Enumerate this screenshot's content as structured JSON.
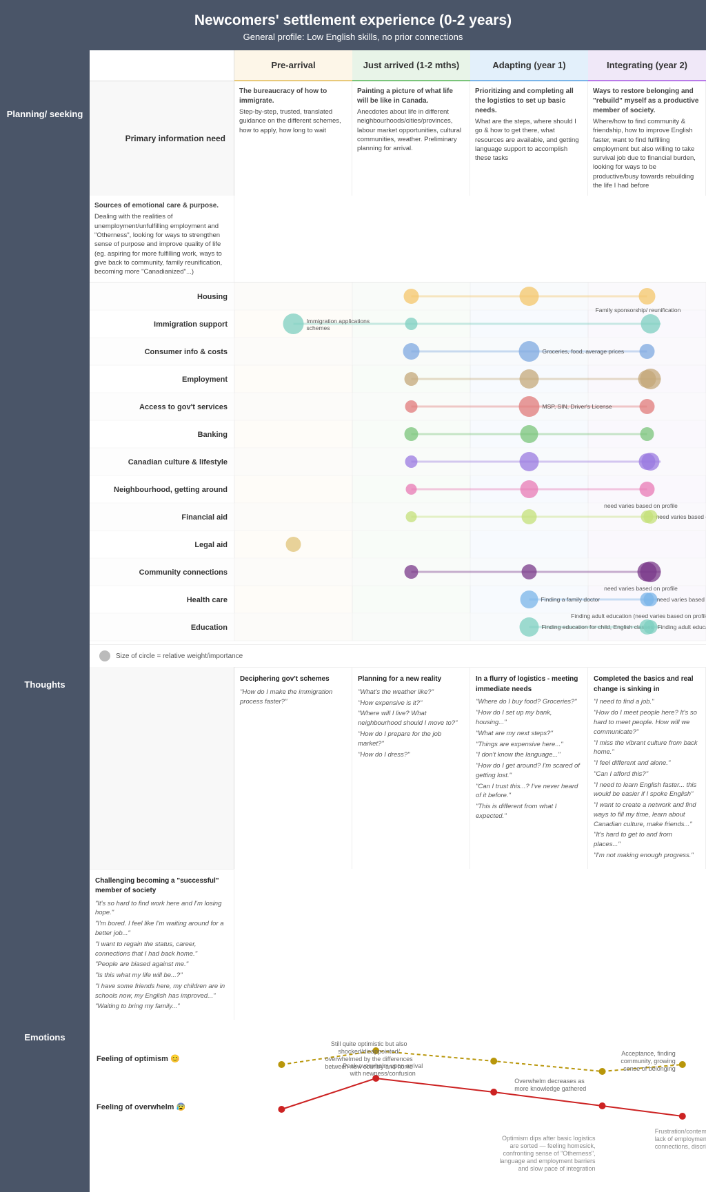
{
  "header": {
    "title": "Newcomers' settlement experience (0-2 years)",
    "subtitle": "General profile: Low English skills, no prior connections"
  },
  "phases": [
    {
      "id": "pre-arrival",
      "label": "Pre-arrival"
    },
    {
      "id": "just-arrived",
      "label": "Just arrived (1-2 mths)"
    },
    {
      "id": "adapting",
      "label": "Adapting (year 1)"
    },
    {
      "id": "integrating",
      "label": "Integrating (year 2)"
    }
  ],
  "sidebar": {
    "planning_label": "Planning/ seeking",
    "thoughts_label": "Thoughts",
    "emotions_label": "Emotions"
  },
  "primary_need": {
    "label": "Primary information need",
    "cells": [
      {
        "title": "The bureaucracy of how to immigrate.",
        "text": "Step-by-step, trusted, translated guidance on the different schemes, how to apply, how long to wait"
      },
      {
        "title": "Painting a picture of what life will be like in Canada.",
        "text": "Anecdotes about life in different neighbourhoods/cities/provinces, labour market opportunities, cultural communities, weather. Preliminary planning for arrival."
      },
      {
        "title": "Prioritizing and completing all the logistics to set up basic needs.",
        "text": "What are the steps, where should I go & how to get there, what resources are available, and getting language support to accomplish these tasks"
      },
      {
        "title": "Ways to restore belonging and \"rebuild\" myself as a productive member of society.",
        "text": "Where/how to find community & friendship, how to improve English faster, want to find fulfilling employment but also willing to take survival job due to financial burden, looking for ways to be productive/busy towards rebuilding the life I had before"
      },
      {
        "title": "Sources of emotional care & purpose.",
        "text": "Dealing with the realities of unemployment/unfulfilling employment and \"Otherness\", looking for ways to strengthen sense of purpose and improve quality of life (eg. aspiring for more fulfilling work, ways to give back to community, family reunification, becoming more \"Canadianized\"...)"
      }
    ]
  },
  "bubble_rows": [
    {
      "label": "Housing",
      "color": "#f4c56a",
      "sizes": [
        0,
        22,
        28,
        24,
        0
      ],
      "labels": [
        "",
        "",
        "",
        "",
        ""
      ]
    },
    {
      "label": "Immigration support",
      "color": "#7ecfc0",
      "sizes": [
        30,
        18,
        0,
        0,
        28
      ],
      "labels": [
        "Immigration applications/schemes",
        "",
        "",
        "Family sponsorship/ reunification",
        ""
      ]
    },
    {
      "label": "Consumer info & costs",
      "color": "#7ea8e0",
      "sizes": [
        0,
        24,
        30,
        22,
        0
      ],
      "labels": [
        "",
        "",
        "Groceries, food, average prices",
        "",
        ""
      ]
    },
    {
      "label": "Employment",
      "color": "#c4a87a",
      "sizes": [
        0,
        20,
        28,
        26,
        30
      ],
      "labels": [
        "",
        "",
        "",
        "",
        ""
      ]
    },
    {
      "label": "Access to gov't services",
      "color": "#e07a7a",
      "sizes": [
        0,
        18,
        30,
        22,
        0
      ],
      "labels": [
        "",
        "",
        "MSP, SIN, Driver's License",
        "",
        ""
      ]
    },
    {
      "label": "Banking",
      "color": "#7ac47a",
      "sizes": [
        0,
        20,
        26,
        20,
        0
      ],
      "labels": [
        "",
        "",
        "",
        "",
        ""
      ]
    },
    {
      "label": "Canadian culture & lifestyle",
      "color": "#9a7ae0",
      "sizes": [
        0,
        18,
        28,
        24,
        26
      ],
      "labels": [
        "",
        "",
        "",
        "",
        ""
      ]
    },
    {
      "label": "Neighbourhood, getting around",
      "color": "#e87ab4",
      "sizes": [
        0,
        16,
        26,
        22,
        0
      ],
      "labels": [
        "",
        "",
        "",
        "",
        ""
      ]
    },
    {
      "label": "Financial aid",
      "color": "#c4e07a",
      "sizes": [
        0,
        16,
        22,
        18,
        20
      ],
      "labels": [
        "",
        "",
        "",
        "need varies based on profile",
        ""
      ]
    },
    {
      "label": "Legal aid",
      "color": "#e0c47a",
      "sizes": [
        22,
        0,
        0,
        0,
        0
      ],
      "labels": [
        "",
        "need varies based on profile",
        "",
        "",
        ""
      ]
    },
    {
      "label": "Community connections",
      "color": "#7a3a8a",
      "sizes": [
        0,
        20,
        22,
        28,
        30
      ],
      "labels": [
        "",
        "",
        "",
        "",
        ""
      ]
    },
    {
      "label": "Health care",
      "color": "#7ab4e8",
      "sizes": [
        0,
        0,
        26,
        20,
        20
      ],
      "labels": [
        "",
        "",
        "Finding a family doctor",
        "need varies based on profile",
        ""
      ]
    },
    {
      "label": "Education",
      "color": "#7ecfc0",
      "sizes": [
        0,
        0,
        28,
        22,
        20
      ],
      "labels": [
        "",
        "",
        "Finding education for child, English classes",
        "Finding adult education (need varies based on profile)",
        ""
      ]
    }
  ],
  "legend": {
    "text": "Size of circle = relative weight/importance"
  },
  "thoughts": {
    "label": "Thoughts",
    "cols": [
      {
        "title": "Deciphering gov't schemes",
        "quotes": [
          "\"How do I make the immigration process faster?\""
        ]
      },
      {
        "title": "Planning for a new reality",
        "quotes": [
          "\"What's the weather like?\"",
          "\"How expensive is it?\"",
          "\"Where will I live? What neighbourhood should I move to?\"",
          "\"How do I prepare for the job market?\"",
          "\"How do I dress?\""
        ]
      },
      {
        "title": "In a flurry of logistics - meeting immediate needs",
        "quotes": [
          "\"Where do I buy food? Groceries?\"",
          "\"How do I set up my bank, housing...\"",
          "\"What are my next steps?\"",
          "\"Things are expensive here...\"",
          "\"I don't know the language...\"",
          "\"How do I get around? I'm scared of getting lost.\"",
          "\"Can I trust this...? I've never heard of it before.\"",
          "\"This is different from what I expected.\""
        ]
      },
      {
        "title": "Completed the basics and real change is sinking in",
        "quotes": [
          "\"I need to find a job.\"",
          "\"How do I meet people here? It's so hard to meet people. How will we communicate?\"",
          "\"I miss the vibrant culture from back home.\"",
          "\"I feel different and alone.\"",
          "\"Can I afford this?\"",
          "\"I need to learn English faster... this would be easier if I spoke English\"",
          "\"I want to create a network and find ways to fill my time, learn about Canadian culture, make friends...\"",
          "\"It's hard to get to and from places...\"",
          "\"I'm not making enough progress.\""
        ]
      },
      {
        "title": "Challenging becoming a \"successful\" member of society",
        "quotes": [
          "\"It's so hard to find work here and I'm losing hope.\"",
          "\"I'm bored. I feel like I'm waiting around for a better job...\"",
          "\"I want to regain the status, career, connections that I had back home.\"",
          "\"People are biased against me.\"",
          "\"Is this what my life will be...?\"",
          "\"I have some friends here, my children are in schools now, my English has improved...\"",
          "\"Waiting to bring my family...\""
        ]
      }
    ]
  },
  "emotions": {
    "label": "Emotions",
    "rows": [
      {
        "label": "Feeling of optimism 😊",
        "color": "#c4a800"
      },
      {
        "label": "Feeling of overwhelm 😰",
        "color": "#cc2222"
      }
    ],
    "annotations": [
      "Peak overwhelm upon arrival with newness/confusion",
      "Still quite optimistic but also shocked/disappointed/ overwhelmed by the differences between new country and home",
      "Overwhelm decreases as more knowledge gathered",
      "Acceptance, finding community, growing sense of belonging",
      "Optimism dips after basic logistics are sorted — feeling homesick, confronting sense of \"Otherness\", language and employment barriers and slow pace of integration",
      "Frustration/contempt with lack of employment, connections, discrimination"
    ]
  }
}
